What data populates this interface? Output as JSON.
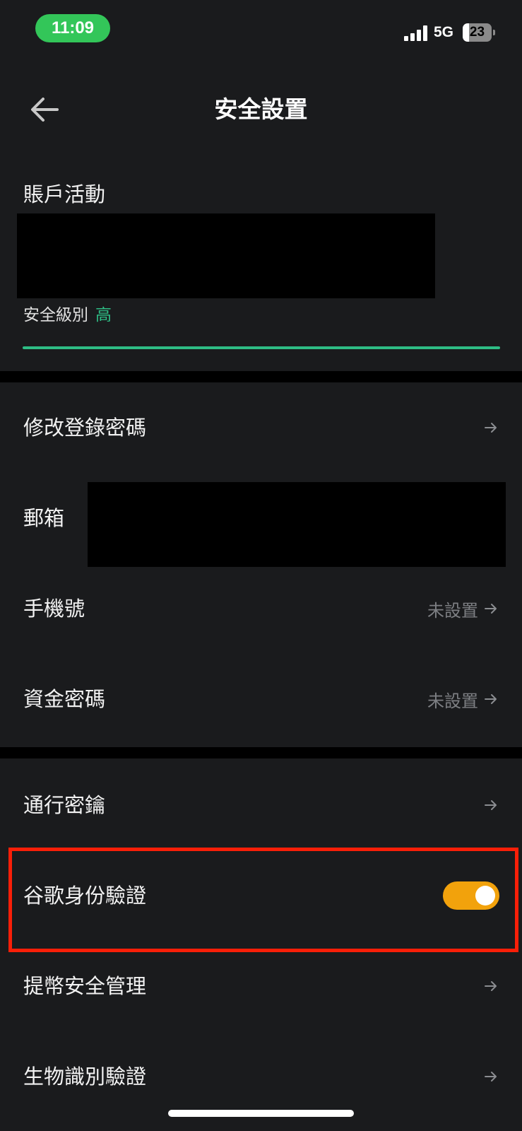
{
  "status_bar": {
    "time": "11:09",
    "network": "5G",
    "battery": "23",
    "battery_level": 0.23,
    "colors": {
      "time_pill": "#33c659"
    }
  },
  "header": {
    "title": "安全設置",
    "back_icon": "arrow-left-icon"
  },
  "account_activity": {
    "title": "賬戶活動",
    "security_level_label": "安全級別",
    "security_level_value": "高",
    "colors": {
      "level": "#2ebd85"
    }
  },
  "settings_group_1": [
    {
      "label": "修改登錄密碼",
      "value": "",
      "icon": "arrow-right-icon"
    },
    {
      "label": "郵箱",
      "value": "",
      "icon": ""
    },
    {
      "label": "手機號",
      "value": "未設置",
      "icon": "arrow-right-icon"
    },
    {
      "label": "資金密碼",
      "value": "未設置",
      "icon": "arrow-right-icon"
    }
  ],
  "settings_group_2": [
    {
      "label": "通行密鑰",
      "value": "",
      "icon": "arrow-right-icon"
    },
    {
      "label": "谷歌身份驗證",
      "value": "",
      "icon": "toggle",
      "toggle_on": true
    },
    {
      "label": "提幣安全管理",
      "value": "",
      "icon": "arrow-right-icon"
    },
    {
      "label": "生物識別驗證",
      "value": "",
      "icon": "arrow-right-icon"
    }
  ],
  "colors": {
    "background": "#1a1b1d",
    "toggle_on": "#f2a20c",
    "highlight": "#f91f08",
    "muted_text": "#7d7f83"
  }
}
